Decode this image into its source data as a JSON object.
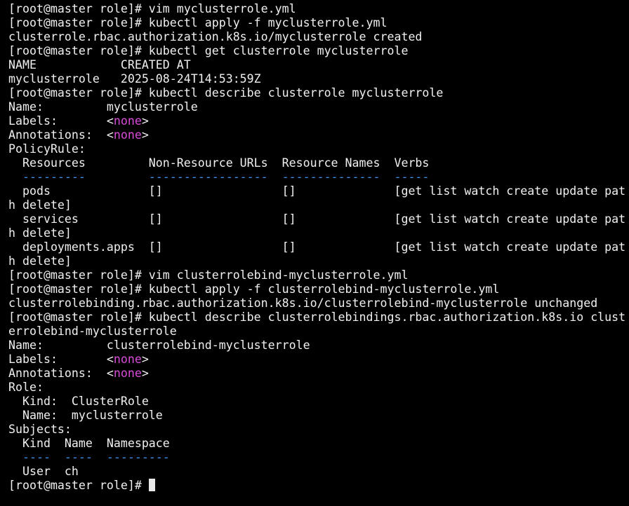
{
  "terminal": {
    "lines": [
      {
        "type": "text",
        "text": "[root@master role]# vim myclusterrole.yml"
      },
      {
        "type": "text",
        "text": "[root@master role]# kubectl apply -f myclusterrole.yml"
      },
      {
        "type": "text",
        "text": "clusterrole.rbac.authorization.k8s.io/myclusterrole created"
      },
      {
        "type": "text",
        "text": "[root@master role]# kubectl get clusterrole myclusterrole"
      },
      {
        "type": "text",
        "text": "NAME            CREATED AT"
      },
      {
        "type": "text",
        "text": "myclusterrole   2025-08-24T14:53:59Z"
      },
      {
        "type": "text",
        "text": "[root@master role]# kubectl describe clusterrole myclusterrole"
      },
      {
        "type": "none",
        "prefix": "Name:         ",
        "value": "myclusterrole",
        "suffix": ""
      },
      {
        "type": "none_tag",
        "prefix": "Labels:       ",
        "value": "none"
      },
      {
        "type": "none_tag",
        "prefix": "Annotations:  ",
        "value": "none"
      },
      {
        "type": "text",
        "text": "PolicyRule:"
      },
      {
        "type": "text",
        "text": "  Resources         Non-Resource URLs  Resource Names  Verbs"
      },
      {
        "type": "dash",
        "text": "  ---------         -----------------  --------------  -----"
      },
      {
        "type": "text",
        "text": "  pods              []                 []              [get list watch create update pat"
      },
      {
        "type": "text",
        "text": "h delete]"
      },
      {
        "type": "text",
        "text": "  services          []                 []              [get list watch create update pat"
      },
      {
        "type": "text",
        "text": "h delete]"
      },
      {
        "type": "text",
        "text": "  deployments.apps  []                 []              [get list watch create update pat"
      },
      {
        "type": "text",
        "text": "h delete]"
      },
      {
        "type": "text",
        "text": "[root@master role]# vim clusterrolebind-myclusterrole.yml"
      },
      {
        "type": "text",
        "text": "[root@master role]# kubectl apply -f clusterrolebind-myclusterrole.yml"
      },
      {
        "type": "text",
        "text": "clusterrolebinding.rbac.authorization.k8s.io/clusterrolebind-myclusterrole unchanged"
      },
      {
        "type": "text",
        "text": "[root@master role]# kubectl describe clusterrolebindings.rbac.authorization.k8s.io clust"
      },
      {
        "type": "text",
        "text": "errolebind-myclusterrole"
      },
      {
        "type": "text",
        "text": "Name:         clusterrolebind-myclusterrole"
      },
      {
        "type": "none_tag",
        "prefix": "Labels:       ",
        "value": "none"
      },
      {
        "type": "none_tag",
        "prefix": "Annotations:  ",
        "value": "none"
      },
      {
        "type": "text",
        "text": "Role:"
      },
      {
        "type": "text",
        "text": "  Kind:  ClusterRole"
      },
      {
        "type": "text",
        "text": "  Name:  myclusterrole"
      },
      {
        "type": "text",
        "text": "Subjects:"
      },
      {
        "type": "text",
        "text": "  Kind  Name  Namespace"
      },
      {
        "type": "dash",
        "text": "  ----  ----  ---------"
      },
      {
        "type": "text",
        "text": "  User  ch"
      },
      {
        "type": "prompt",
        "text": "[root@master role]# "
      }
    ]
  },
  "colors": {
    "background": "#000000",
    "foreground": "#f0f0f0",
    "none_highlight": "#d94bd9",
    "dash_highlight": "#3e8ef0"
  }
}
